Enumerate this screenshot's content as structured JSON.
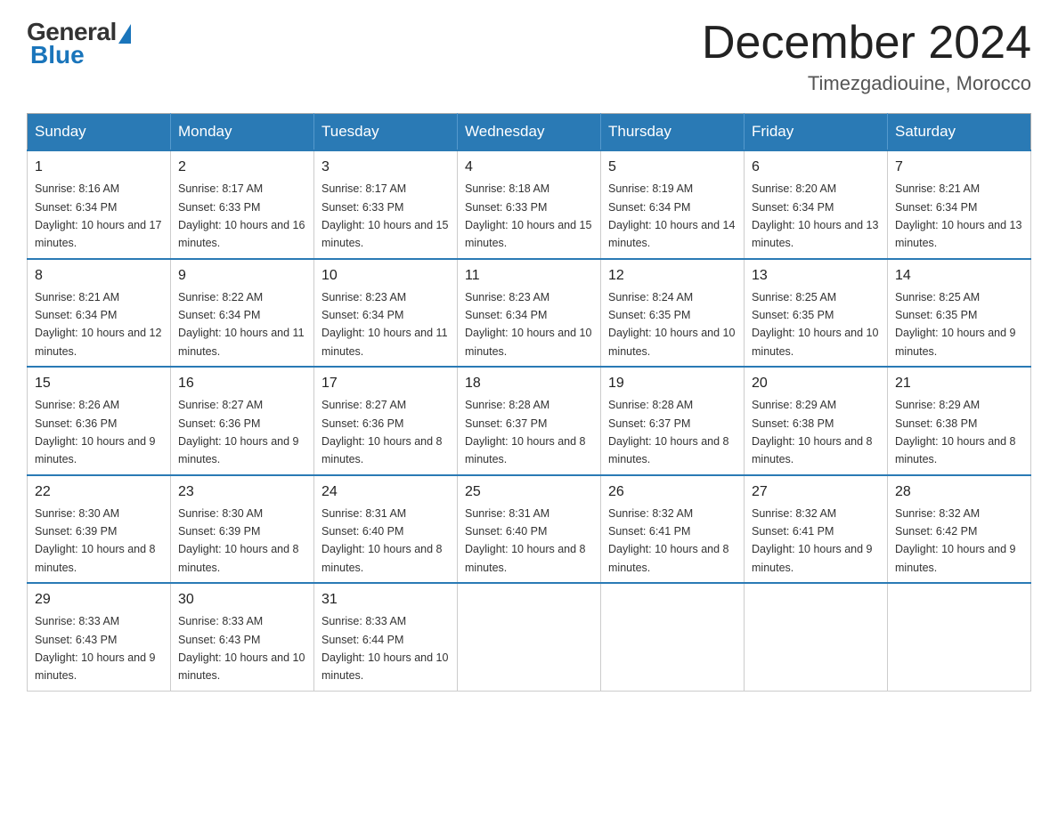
{
  "logo": {
    "general": "General",
    "blue": "Blue"
  },
  "header": {
    "month": "December 2024",
    "location": "Timezgadiouine, Morocco"
  },
  "weekdays": [
    "Sunday",
    "Monday",
    "Tuesday",
    "Wednesday",
    "Thursday",
    "Friday",
    "Saturday"
  ],
  "weeks": [
    [
      {
        "day": "1",
        "sunrise": "8:16 AM",
        "sunset": "6:34 PM",
        "daylight": "10 hours and 17 minutes."
      },
      {
        "day": "2",
        "sunrise": "8:17 AM",
        "sunset": "6:33 PM",
        "daylight": "10 hours and 16 minutes."
      },
      {
        "day": "3",
        "sunrise": "8:17 AM",
        "sunset": "6:33 PM",
        "daylight": "10 hours and 15 minutes."
      },
      {
        "day": "4",
        "sunrise": "8:18 AM",
        "sunset": "6:33 PM",
        "daylight": "10 hours and 15 minutes."
      },
      {
        "day": "5",
        "sunrise": "8:19 AM",
        "sunset": "6:34 PM",
        "daylight": "10 hours and 14 minutes."
      },
      {
        "day": "6",
        "sunrise": "8:20 AM",
        "sunset": "6:34 PM",
        "daylight": "10 hours and 13 minutes."
      },
      {
        "day": "7",
        "sunrise": "8:21 AM",
        "sunset": "6:34 PM",
        "daylight": "10 hours and 13 minutes."
      }
    ],
    [
      {
        "day": "8",
        "sunrise": "8:21 AM",
        "sunset": "6:34 PM",
        "daylight": "10 hours and 12 minutes."
      },
      {
        "day": "9",
        "sunrise": "8:22 AM",
        "sunset": "6:34 PM",
        "daylight": "10 hours and 11 minutes."
      },
      {
        "day": "10",
        "sunrise": "8:23 AM",
        "sunset": "6:34 PM",
        "daylight": "10 hours and 11 minutes."
      },
      {
        "day": "11",
        "sunrise": "8:23 AM",
        "sunset": "6:34 PM",
        "daylight": "10 hours and 10 minutes."
      },
      {
        "day": "12",
        "sunrise": "8:24 AM",
        "sunset": "6:35 PM",
        "daylight": "10 hours and 10 minutes."
      },
      {
        "day": "13",
        "sunrise": "8:25 AM",
        "sunset": "6:35 PM",
        "daylight": "10 hours and 10 minutes."
      },
      {
        "day": "14",
        "sunrise": "8:25 AM",
        "sunset": "6:35 PM",
        "daylight": "10 hours and 9 minutes."
      }
    ],
    [
      {
        "day": "15",
        "sunrise": "8:26 AM",
        "sunset": "6:36 PM",
        "daylight": "10 hours and 9 minutes."
      },
      {
        "day": "16",
        "sunrise": "8:27 AM",
        "sunset": "6:36 PM",
        "daylight": "10 hours and 9 minutes."
      },
      {
        "day": "17",
        "sunrise": "8:27 AM",
        "sunset": "6:36 PM",
        "daylight": "10 hours and 8 minutes."
      },
      {
        "day": "18",
        "sunrise": "8:28 AM",
        "sunset": "6:37 PM",
        "daylight": "10 hours and 8 minutes."
      },
      {
        "day": "19",
        "sunrise": "8:28 AM",
        "sunset": "6:37 PM",
        "daylight": "10 hours and 8 minutes."
      },
      {
        "day": "20",
        "sunrise": "8:29 AM",
        "sunset": "6:38 PM",
        "daylight": "10 hours and 8 minutes."
      },
      {
        "day": "21",
        "sunrise": "8:29 AM",
        "sunset": "6:38 PM",
        "daylight": "10 hours and 8 minutes."
      }
    ],
    [
      {
        "day": "22",
        "sunrise": "8:30 AM",
        "sunset": "6:39 PM",
        "daylight": "10 hours and 8 minutes."
      },
      {
        "day": "23",
        "sunrise": "8:30 AM",
        "sunset": "6:39 PM",
        "daylight": "10 hours and 8 minutes."
      },
      {
        "day": "24",
        "sunrise": "8:31 AM",
        "sunset": "6:40 PM",
        "daylight": "10 hours and 8 minutes."
      },
      {
        "day": "25",
        "sunrise": "8:31 AM",
        "sunset": "6:40 PM",
        "daylight": "10 hours and 8 minutes."
      },
      {
        "day": "26",
        "sunrise": "8:32 AM",
        "sunset": "6:41 PM",
        "daylight": "10 hours and 8 minutes."
      },
      {
        "day": "27",
        "sunrise": "8:32 AM",
        "sunset": "6:41 PM",
        "daylight": "10 hours and 9 minutes."
      },
      {
        "day": "28",
        "sunrise": "8:32 AM",
        "sunset": "6:42 PM",
        "daylight": "10 hours and 9 minutes."
      }
    ],
    [
      {
        "day": "29",
        "sunrise": "8:33 AM",
        "sunset": "6:43 PM",
        "daylight": "10 hours and 9 minutes."
      },
      {
        "day": "30",
        "sunrise": "8:33 AM",
        "sunset": "6:43 PM",
        "daylight": "10 hours and 10 minutes."
      },
      {
        "day": "31",
        "sunrise": "8:33 AM",
        "sunset": "6:44 PM",
        "daylight": "10 hours and 10 minutes."
      },
      null,
      null,
      null,
      null
    ]
  ]
}
